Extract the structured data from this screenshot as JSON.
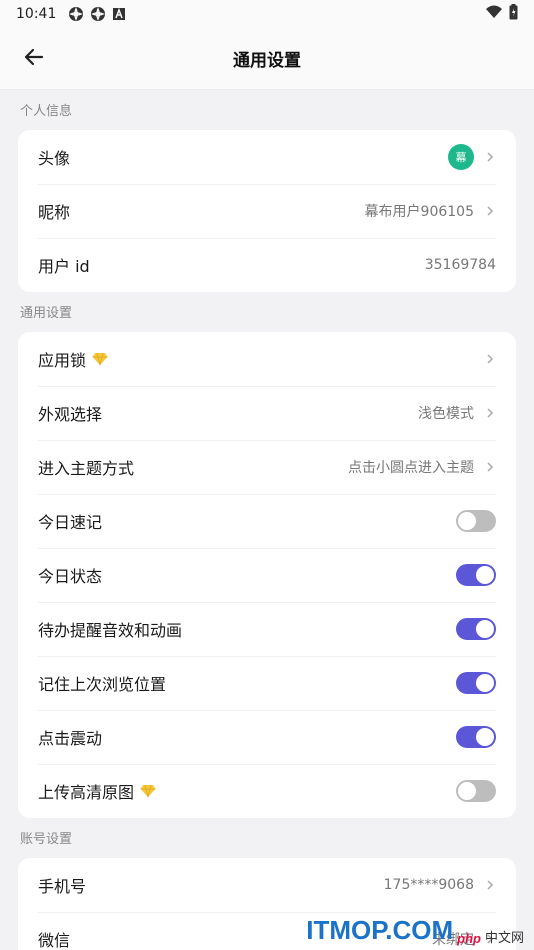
{
  "status_bar": {
    "time": "10:41"
  },
  "header": {
    "title": "通用设置"
  },
  "sections": [
    {
      "title": "个人信息",
      "rows": [
        {
          "label": "头像",
          "avatar_text": "幕"
        },
        {
          "label": "昵称",
          "value": "幕布用户906105"
        },
        {
          "label": "用户 id",
          "value": "35169784"
        }
      ]
    },
    {
      "title": "通用设置",
      "rows": [
        {
          "label": "应用锁"
        },
        {
          "label": "外观选择",
          "value": "浅色模式"
        },
        {
          "label": "进入主题方式",
          "value": "点击小圆点进入主题"
        },
        {
          "label": "今日速记",
          "toggle": false
        },
        {
          "label": "今日状态",
          "toggle": true
        },
        {
          "label": "待办提醒音效和动画",
          "toggle": true
        },
        {
          "label": "记住上次浏览位置",
          "toggle": true
        },
        {
          "label": "点击震动",
          "toggle": true
        },
        {
          "label": "上传高清原图",
          "toggle": false
        }
      ]
    },
    {
      "title": "账号设置",
      "rows": [
        {
          "label": "手机号",
          "value": "175****9068"
        },
        {
          "label": "微信",
          "value": "未绑定"
        }
      ]
    }
  ],
  "watermark": {
    "main": "ITMOP.COM",
    "small": "php",
    "cn": "中文网"
  },
  "colors": {
    "accent": "#5b57d6",
    "avatar": "#1db98d",
    "gem": "#f5c842"
  }
}
